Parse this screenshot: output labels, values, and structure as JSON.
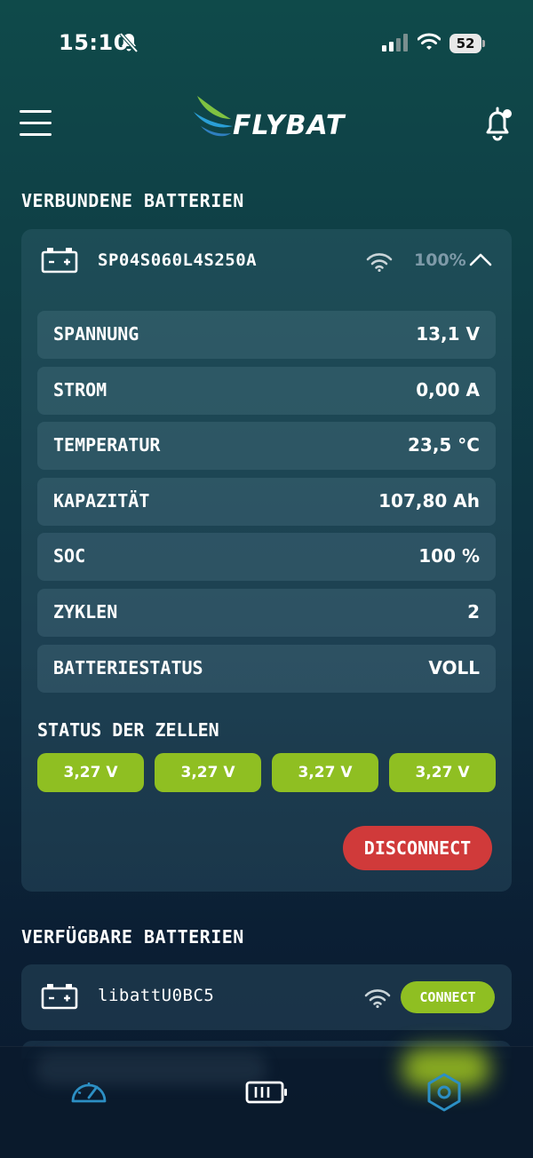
{
  "status_bar": {
    "time": "15:10",
    "battery": "52"
  },
  "header": {
    "logo_text": "FLYBAT"
  },
  "connected": {
    "section_title": "VERBUNDENE BATTERIEN",
    "device": {
      "name": "SP04S060L4S250A",
      "signal": "100%"
    },
    "metrics": [
      {
        "label": "SPANNUNG",
        "value": "13,1 V"
      },
      {
        "label": "STROM",
        "value": "0,00 A"
      },
      {
        "label": "TEMPERATUR",
        "value": "23,5 °C"
      },
      {
        "label": "KAPAZITÄT",
        "value": "107,80 Ah"
      },
      {
        "label": "SOC",
        "value": "100 %"
      },
      {
        "label": "ZYKLEN",
        "value": "2"
      },
      {
        "label": "BATTERIESTATUS",
        "value": "VOLL"
      }
    ],
    "cells_title": "STATUS DER ZELLEN",
    "cells": [
      "3,27 V",
      "3,27 V",
      "3,27 V",
      "3,27 V"
    ],
    "disconnect_label": "DISCONNECT"
  },
  "available": {
    "section_title": "VERFÜGBARE BATTERIEN",
    "devices": [
      {
        "name": "libattU0BC5",
        "connect_label": "CONNECT"
      }
    ]
  },
  "colors": {
    "accent_green": "#8fbf22",
    "danger_red": "#d03a3a",
    "muted_text": "#7e9aa8"
  },
  "tabs": [
    {
      "icon": "gauge-icon",
      "active": false
    },
    {
      "icon": "battery-icon",
      "active": false
    },
    {
      "icon": "settings-hexagon-icon",
      "active": true
    }
  ]
}
